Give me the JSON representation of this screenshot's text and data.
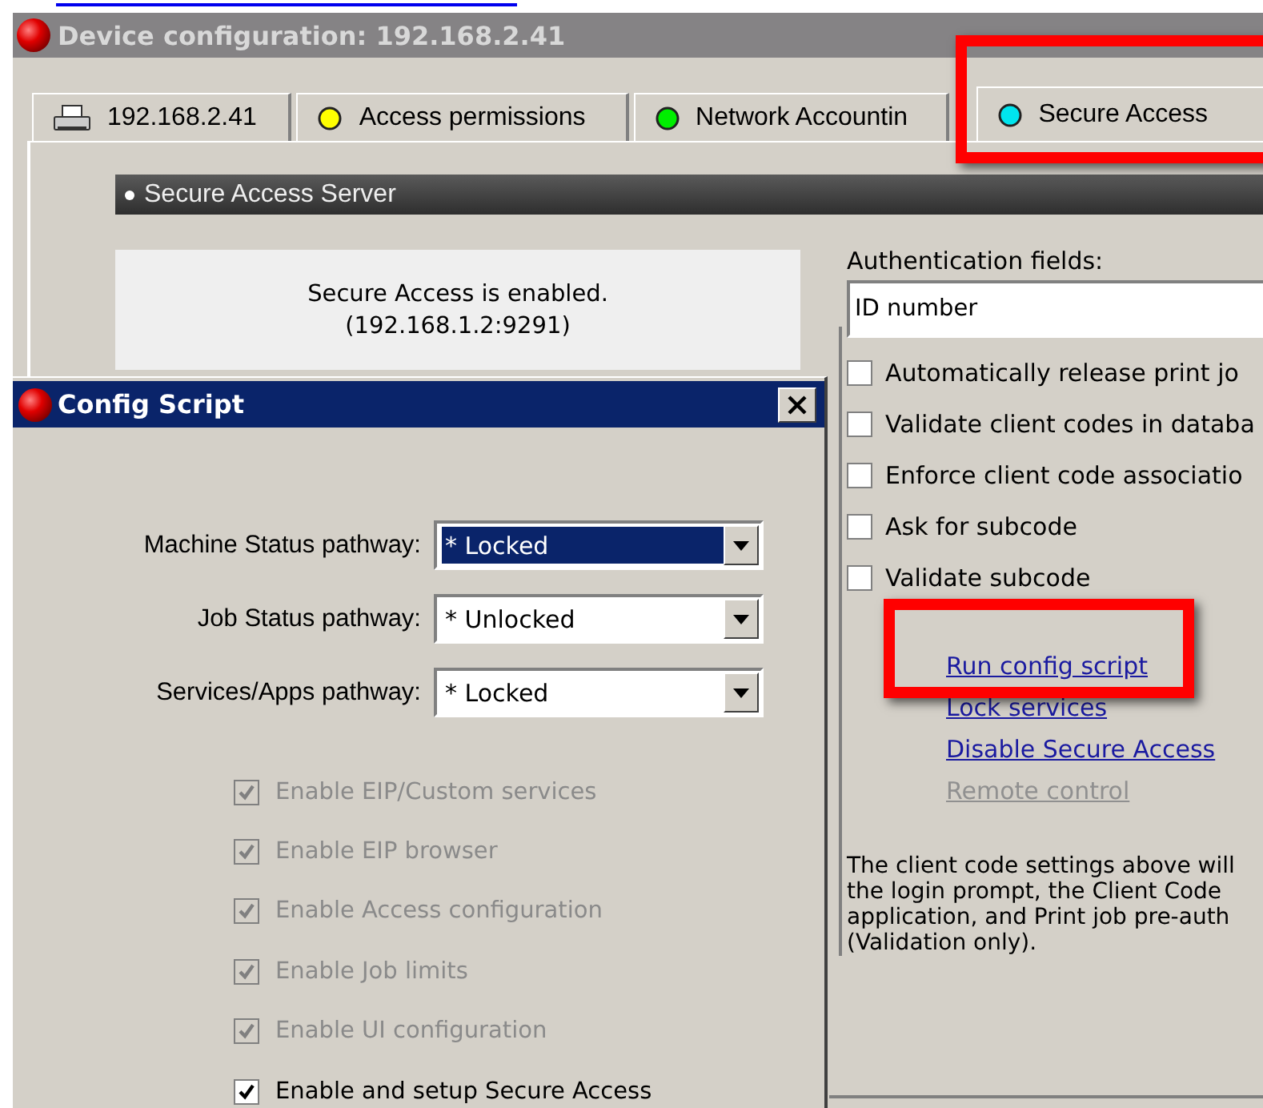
{
  "window": {
    "title": "Device configuration: 192.168.2.41"
  },
  "tabs": [
    {
      "label": "192.168.2.41",
      "kind": "printer",
      "selected": false
    },
    {
      "label": "Access permissions",
      "kind": "dot",
      "color": "#ffff00",
      "selected": false
    },
    {
      "label": "Network Accountin",
      "kind": "dot",
      "color": "#00ee00",
      "selected": false
    },
    {
      "label": "Secure Access",
      "kind": "dot",
      "color": "#00e5ee",
      "selected": true
    }
  ],
  "section_header": "Secure Access Server",
  "status_text": "Secure Access is enabled.\n(192.168.1.2:9291)",
  "auth": {
    "label": "Authentication fields:",
    "value": "ID number"
  },
  "options": [
    {
      "label": "Automatically release print jo",
      "checked": false
    },
    {
      "label": "Validate client codes in databa",
      "checked": false
    },
    {
      "label": "Enforce client code associatio",
      "checked": false
    },
    {
      "label": "Ask for subcode",
      "checked": false
    },
    {
      "label": "Validate subcode",
      "checked": false
    }
  ],
  "links": [
    {
      "label": "Run config script",
      "disabled": false
    },
    {
      "label": "Lock services",
      "disabled": false
    },
    {
      "label": "Disable Secure Access",
      "disabled": false
    },
    {
      "label": "Remote control",
      "disabled": true
    }
  ],
  "note": "The client code settings above will\nthe login prompt, the Client Code\napplication, and Print job pre-auth\n(Validation only).",
  "dialog": {
    "title": "Config Script",
    "fields": [
      {
        "label": "Machine Status pathway:",
        "value": "* Locked",
        "selected": true
      },
      {
        "label": "Job Status pathway:",
        "value": "* Unlocked",
        "selected": false
      },
      {
        "label": "Services/Apps pathway:",
        "value": "* Locked",
        "selected": false
      }
    ],
    "options": [
      {
        "label": "Enable EIP/Custom services",
        "checked": true,
        "disabled": true
      },
      {
        "label": "Enable EIP browser",
        "checked": true,
        "disabled": true
      },
      {
        "label": "Enable Access configuration",
        "checked": true,
        "disabled": true
      },
      {
        "label": "Enable Job limits",
        "checked": true,
        "disabled": true
      },
      {
        "label": "Enable UI configuration",
        "checked": true,
        "disabled": true
      },
      {
        "label": "Enable and setup Secure Access",
        "checked": true,
        "disabled": false
      }
    ]
  }
}
